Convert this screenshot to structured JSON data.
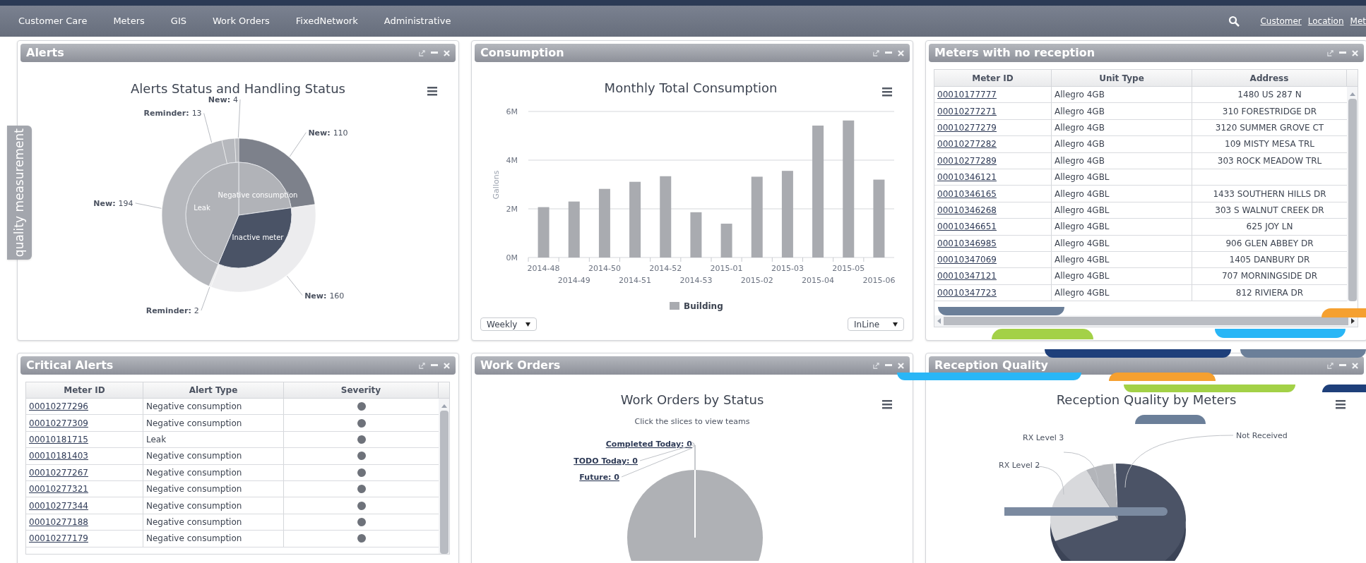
{
  "nav": {
    "items": [
      "Customer Care",
      "Meters",
      "GIS",
      "Work Orders",
      "FixedNetwork",
      "Administrative"
    ],
    "links": [
      "Customer",
      "Location",
      "Met"
    ]
  },
  "side_tab": "quality measurement",
  "alerts": {
    "title": "Alerts",
    "chart_title": "Alerts Status and Handling Status",
    "chart": {
      "kind": "donut",
      "inner_labels": [
        "Negative consumption",
        "Inactive meter",
        "Leak"
      ],
      "slice_labels": [
        {
          "name": "New:",
          "value": "110"
        },
        {
          "name": "New:",
          "value": "160"
        },
        {
          "name": "Reminder:",
          "value": "2"
        },
        {
          "name": "New:",
          "value": "194"
        },
        {
          "name": "Reminder:",
          "value": "13"
        },
        {
          "name": "New:",
          "value": "4"
        }
      ]
    }
  },
  "consumption": {
    "title": "Consumption",
    "chart_data": {
      "type": "bar",
      "title": "Monthly Total Consumption",
      "ylabel": "Gallons",
      "categories": [
        "2014-48",
        "2014-49",
        "2014-50",
        "2014-51",
        "2014-52",
        "2014-53",
        "2015-01",
        "2015-02",
        "2015-03",
        "2015-04",
        "2015-05",
        "2015-06"
      ],
      "series": [
        {
          "name": "Building",
          "color": "#a9abb0",
          "values": [
            2070000,
            2300000,
            2820000,
            3110000,
            3340000,
            1860000,
            1390000,
            3320000,
            3560000,
            5420000,
            5630000,
            3200000
          ]
        }
      ],
      "ylim": [
        0,
        6000000
      ],
      "yticks": [
        {
          "value": 0,
          "label": "0M"
        },
        {
          "value": 2000000,
          "label": "2M"
        },
        {
          "value": 4000000,
          "label": "4M"
        },
        {
          "value": 6000000,
          "label": "6M"
        }
      ]
    },
    "period": "Weekly",
    "source": "InLine"
  },
  "meters": {
    "title": "Meters with no reception",
    "columns": [
      "Meter ID",
      "Unit Type",
      "Address"
    ],
    "rows": [
      {
        "id": "00010177777",
        "type": "Allegro 4GB",
        "address": "1480 US 287 N"
      },
      {
        "id": "00010277271",
        "type": "Allegro 4GB",
        "address": "310 FORESTRIDGE DR"
      },
      {
        "id": "00010277279",
        "type": "Allegro 4GB",
        "address": "3120 SUMMER GROVE CT"
      },
      {
        "id": "00010277282",
        "type": "Allegro 4GB",
        "address": "109 MISTY MESA TRL"
      },
      {
        "id": "00010277289",
        "type": "Allegro 4GB",
        "address": "303 ROCK MEADOW TRL"
      },
      {
        "id": "00010346121",
        "type": "Allegro 4GBL",
        "address": ""
      },
      {
        "id": "00010346165",
        "type": "Allegro 4GBL",
        "address": "1433 SOUTHERN HILLS DR"
      },
      {
        "id": "00010346268",
        "type": "Allegro 4GBL",
        "address": "303 S WALNUT CREEK DR"
      },
      {
        "id": "00010346651",
        "type": "Allegro 4GBL",
        "address": "625 JOY LN"
      },
      {
        "id": "00010346985",
        "type": "Allegro 4GBL",
        "address": "906 GLEN ABBEY DR"
      },
      {
        "id": "00010347069",
        "type": "Allegro 4GBL",
        "address": "1405 DANBURY DR"
      },
      {
        "id": "00010347121",
        "type": "Allegro 4GBL",
        "address": "707 MORNINGSIDE DR"
      },
      {
        "id": "00010347723",
        "type": "Allegro 4GBL",
        "address": "812 RIVIERA DR"
      }
    ]
  },
  "critical": {
    "title": "Critical Alerts",
    "columns": [
      "Meter ID",
      "Alert Type",
      "Severity"
    ],
    "rows": [
      {
        "id": "00010277296",
        "type": "Negative consumption",
        "color": "#6e727a"
      },
      {
        "id": "00010277309",
        "type": "Negative consumption",
        "color": "#6e727a"
      },
      {
        "id": "00010181715",
        "type": "Leak",
        "color": "#6e727a"
      },
      {
        "id": "00010181403",
        "type": "Negative consumption",
        "color": "#6e727a"
      },
      {
        "id": "00010277267",
        "type": "Negative consumption",
        "color": "#6e727a"
      },
      {
        "id": "00010277321",
        "type": "Negative consumption",
        "color": "#6e727a"
      },
      {
        "id": "00010277344",
        "type": "Negative consumption",
        "color": "#6e727a"
      },
      {
        "id": "00010277188",
        "type": "Negative consumption",
        "color": "#6e727a"
      },
      {
        "id": "00010277179",
        "type": "Negative consumption",
        "color": "#6e727a"
      }
    ]
  },
  "work_orders": {
    "title": "Work Orders",
    "chart_title": "Work Orders by Status",
    "subtitle": "Click the slices to view teams",
    "labels": [
      "Completed Today: 0",
      "TODO Today: 0",
      "Future: 0"
    ]
  },
  "reception": {
    "title": "Reception Quality",
    "chart_title": "Reception Quality by Meters",
    "labels": [
      "RX Level 3",
      "RX Level 2",
      "Not Received"
    ]
  }
}
